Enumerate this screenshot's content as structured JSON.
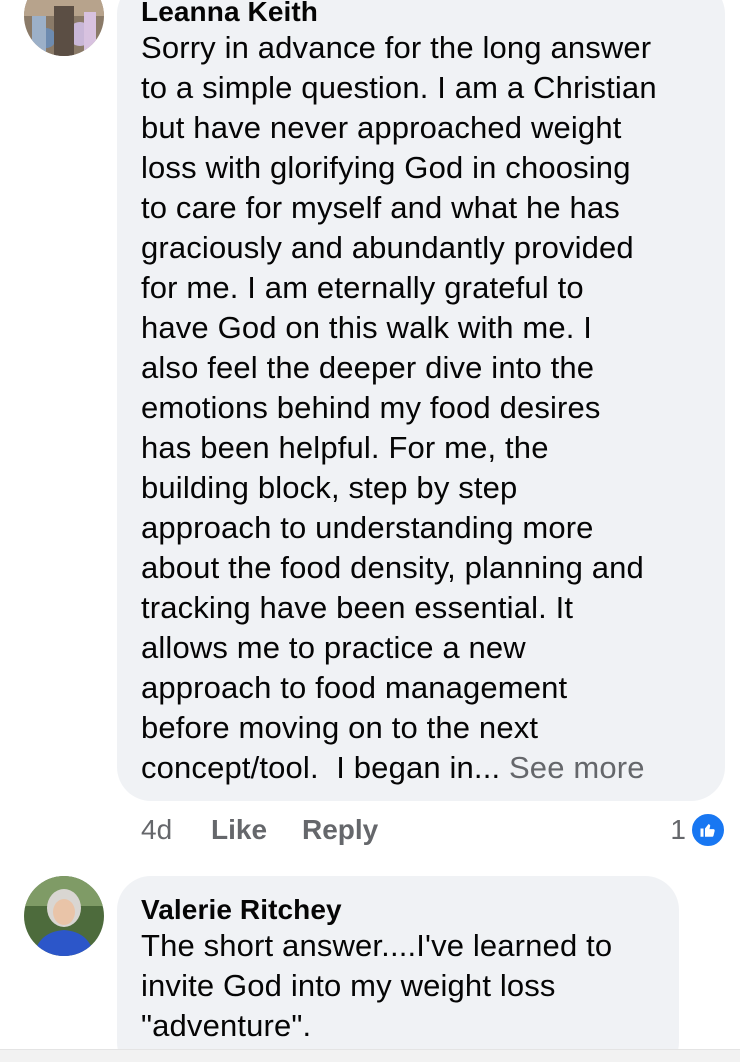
{
  "comments": [
    {
      "author": "Leanna Keith",
      "lines": [
        "Sorry in advance for the long answer",
        "to a simple question. I am a Christian",
        "but have never approached weight",
        "loss with glorifying God in choosing",
        "to care for myself and what he has",
        "graciously and abundantly provided",
        "for me. I am eternally grateful to",
        "have God on this walk with me.  I",
        "also feel the deeper dive into the",
        "emotions behind my food desires",
        "has been helpful.  For me, the",
        "building block, step by step",
        "approach to understanding more",
        "about the food density, planning and",
        "tracking have been essential.  It",
        "allows me to practice a new",
        "approach to food management",
        "before moving on to the next",
        "concept/tool.  I began in... "
      ],
      "see_more": "See more",
      "time": "4d",
      "like_label": "Like",
      "reply_label": "Reply",
      "reaction_count": "1",
      "reaction_icon": "thumbs-up-icon"
    },
    {
      "author": "Valerie Ritchey",
      "lines": [
        "The short answer....I've learned to",
        "invite God into my weight loss",
        "\"adventure\"."
      ]
    }
  ],
  "colors": {
    "bubble": "#f0f2f5",
    "secondary_text": "#65676b",
    "like_blue": "#1877f2"
  }
}
